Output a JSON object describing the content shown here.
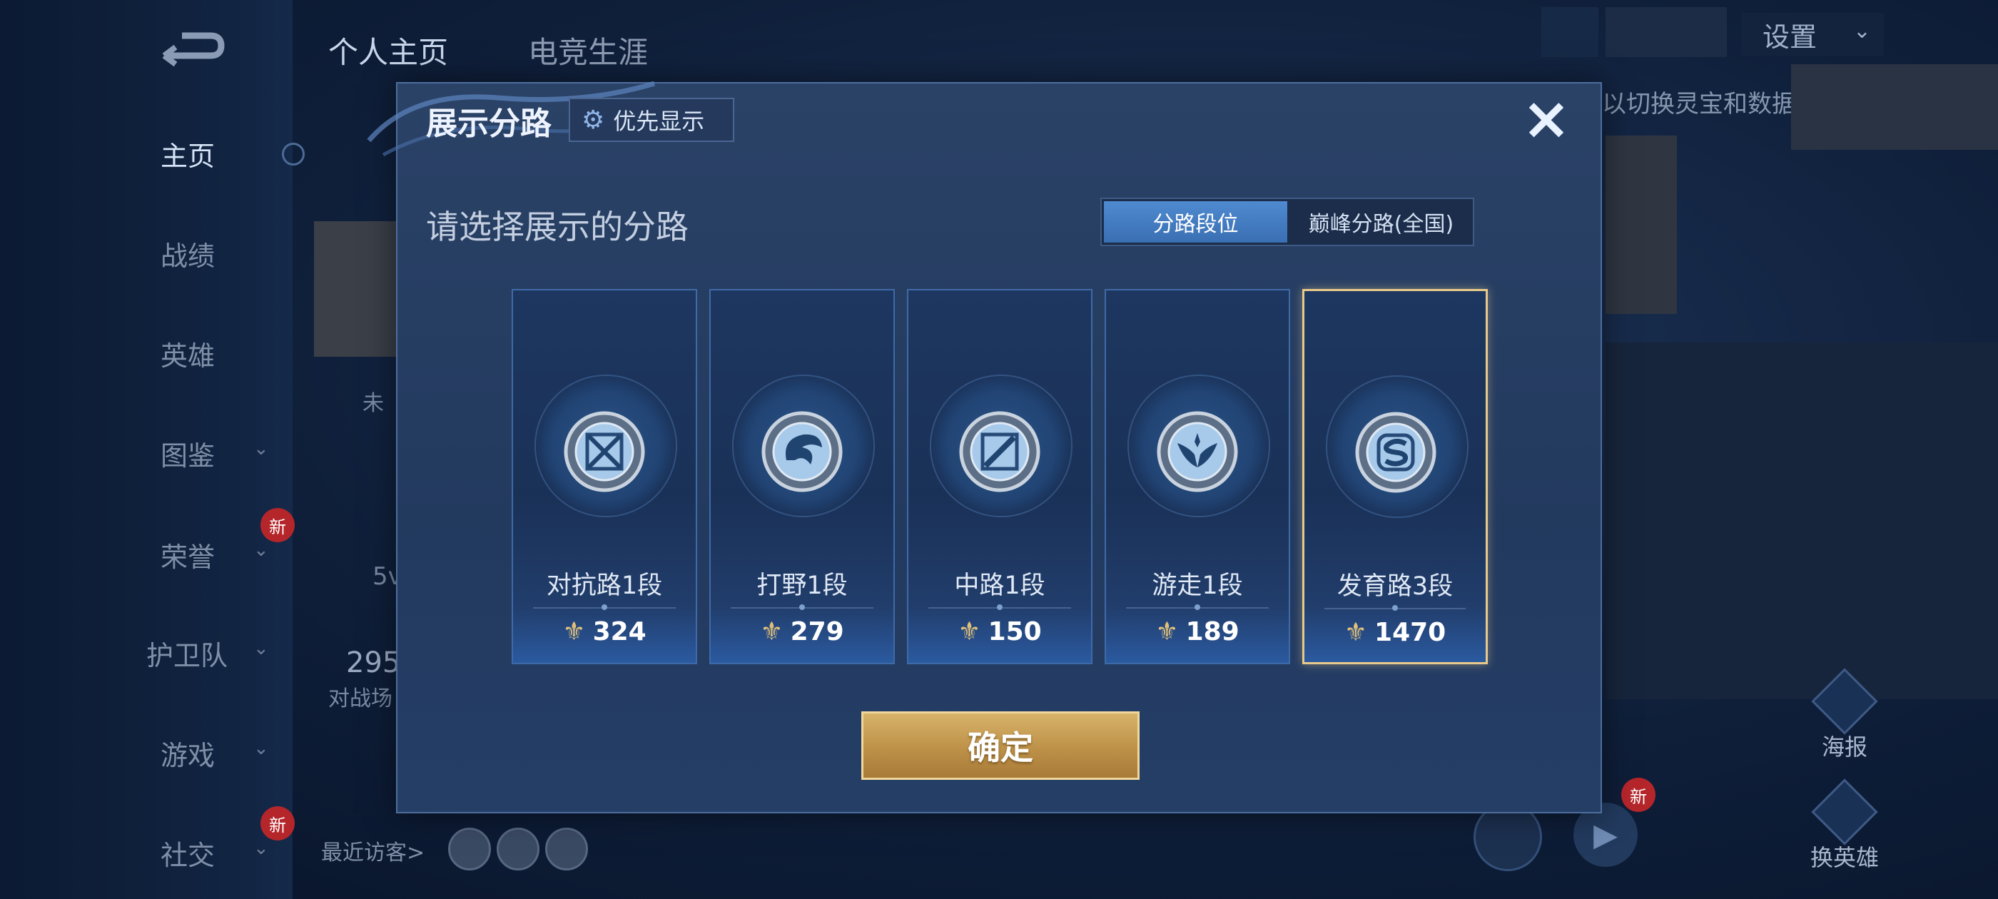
{
  "sidebar": {
    "items": [
      {
        "label": "主页",
        "has_chevron": false,
        "is_new": false,
        "active": true
      },
      {
        "label": "战绩",
        "has_chevron": false,
        "is_new": false,
        "active": false
      },
      {
        "label": "英雄",
        "has_chevron": false,
        "is_new": false,
        "active": false
      },
      {
        "label": "图鉴",
        "has_chevron": true,
        "is_new": false,
        "active": false
      },
      {
        "label": "荣誉",
        "has_chevron": true,
        "is_new": true,
        "active": false
      },
      {
        "label": "护卫队",
        "has_chevron": true,
        "is_new": false,
        "active": false
      },
      {
        "label": "游戏",
        "has_chevron": true,
        "is_new": false,
        "active": false
      },
      {
        "label": "社交",
        "has_chevron": true,
        "is_new": true,
        "active": false
      }
    ],
    "new_badge": "新"
  },
  "header": {
    "tabs": [
      "个人主页",
      "电竞生涯"
    ],
    "settings_label": "设置",
    "hint_text": "以切换灵宝和数据展示"
  },
  "background": {
    "partial_text_1": "未",
    "partial_text_2": "5v",
    "partial_text_3": "295",
    "partial_text_4": "对战场",
    "recent_visitors": "最近访客>",
    "poster_label": "海报",
    "switch_hero_label": "换英雄",
    "new_badge_right": "新"
  },
  "modal": {
    "title": "展示分路",
    "priority_button": "优先显示",
    "close_icon": "×",
    "subtitle": "请选择展示的分路",
    "segments": [
      {
        "label": "分路段位",
        "active": true
      },
      {
        "label": "巅峰分路(全国)",
        "active": false
      }
    ],
    "lanes": [
      {
        "name": "对抗路1段",
        "score": "324",
        "icon": "crossed-swords-emblem-icon",
        "selected": false
      },
      {
        "name": "打野1段",
        "score": "279",
        "icon": "dragon-emblem-icon",
        "selected": false
      },
      {
        "name": "中路1段",
        "score": "150",
        "icon": "slash-emblem-icon",
        "selected": false
      },
      {
        "name": "游走1段",
        "score": "189",
        "icon": "wings-emblem-icon",
        "selected": false
      },
      {
        "name": "发育路3段",
        "score": "1470",
        "icon": "s-emblem-icon",
        "selected": true
      }
    ],
    "confirm_label": "确定"
  },
  "colors": {
    "accent_blue": "#3a6fb3",
    "gold": "#e7c98a",
    "confirm_gold": "#bd9148",
    "panel_bg": "#2b4267"
  }
}
